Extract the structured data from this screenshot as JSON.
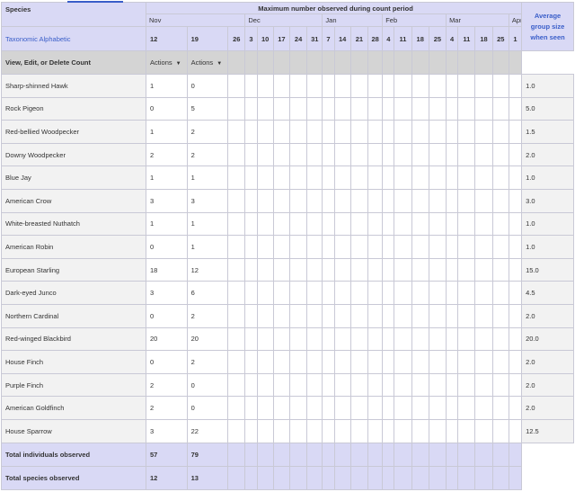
{
  "header": {
    "species_label": "Species",
    "taxonomic_link": "Taxonomic Alphabetic",
    "max_label": "Maximum number observed during count period",
    "avg_label_1": "Average",
    "avg_label_2": "group size",
    "avg_label_3": "when seen",
    "months": [
      "Nov",
      "Dec",
      "Jan",
      "Feb",
      "Mar",
      "Apr"
    ],
    "dates": [
      "12",
      "19",
      "26",
      "3",
      "10",
      "17",
      "24",
      "31",
      "7",
      "14",
      "21",
      "28",
      "4",
      "11",
      "18",
      "25",
      "4",
      "11",
      "18",
      "25",
      "1"
    ]
  },
  "actions_row": {
    "label": "View, Edit, or Delete Count",
    "action_1": "Actions",
    "action_2": "Actions"
  },
  "species": [
    {
      "name": "Sharp-shinned Hawk",
      "c1": "1",
      "c2": "0",
      "avg": "1.0"
    },
    {
      "name": "Rock Pigeon",
      "c1": "0",
      "c2": "5",
      "avg": "5.0"
    },
    {
      "name": "Red-bellied Woodpecker",
      "c1": "1",
      "c2": "2",
      "avg": "1.5"
    },
    {
      "name": "Downy Woodpecker",
      "c1": "2",
      "c2": "2",
      "avg": "2.0"
    },
    {
      "name": "Blue Jay",
      "c1": "1",
      "c2": "1",
      "avg": "1.0"
    },
    {
      "name": "American Crow",
      "c1": "3",
      "c2": "3",
      "avg": "3.0"
    },
    {
      "name": "White-breasted Nuthatch",
      "c1": "1",
      "c2": "1",
      "avg": "1.0"
    },
    {
      "name": "American Robin",
      "c1": "0",
      "c2": "1",
      "avg": "1.0"
    },
    {
      "name": "European Starling",
      "c1": "18",
      "c2": "12",
      "avg": "15.0"
    },
    {
      "name": "Dark-eyed Junco",
      "c1": "3",
      "c2": "6",
      "avg": "4.5"
    },
    {
      "name": "Northern Cardinal",
      "c1": "0",
      "c2": "2",
      "avg": "2.0"
    },
    {
      "name": "Red-winged Blackbird",
      "c1": "20",
      "c2": "20",
      "avg": "20.0"
    },
    {
      "name": "House Finch",
      "c1": "0",
      "c2": "2",
      "avg": "2.0"
    },
    {
      "name": "Purple Finch",
      "c1": "2",
      "c2": "0",
      "avg": "2.0"
    },
    {
      "name": "American Goldfinch",
      "c1": "2",
      "c2": "0",
      "avg": "2.0"
    },
    {
      "name": "House Sparrow",
      "c1": "3",
      "c2": "22",
      "avg": "12.5"
    }
  ],
  "totals": {
    "individuals_label": "Total individuals observed",
    "individuals_c1": "57",
    "individuals_c2": "79",
    "species_label": "Total species observed",
    "species_c1": "12",
    "species_c2": "13"
  },
  "colors": {
    "header_bg": "#d9d9f5",
    "link": "#3a5ec9",
    "actions_bg": "#d4d4d4"
  }
}
